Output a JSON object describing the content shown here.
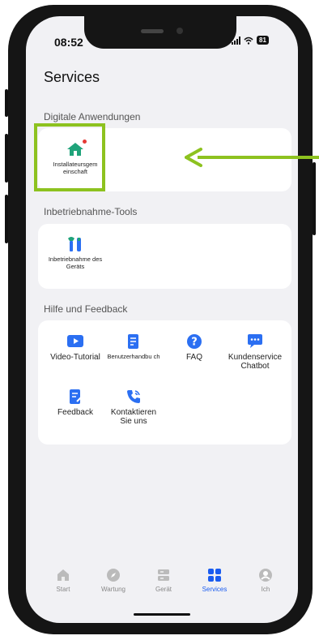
{
  "status": {
    "time": "08:52",
    "battery": "81"
  },
  "page": {
    "title": "Services"
  },
  "sections": {
    "digital": {
      "heading": "Digitale Anwendungen",
      "items": [
        {
          "label": "Installateursgem einschaft",
          "icon": "house-icon"
        }
      ]
    },
    "commissioning": {
      "heading": "Inbetriebnahme-Tools",
      "items": [
        {
          "label": "Inbetriebnahme des Geräts",
          "icon": "tools-icon"
        }
      ]
    },
    "help": {
      "heading": "Hilfe und Feedback",
      "items": [
        {
          "label": "Video-Tutorial",
          "icon": "play-icon"
        },
        {
          "label": "Benutzerhandbu ch",
          "icon": "manual-icon"
        },
        {
          "label": "FAQ",
          "icon": "question-icon"
        },
        {
          "label": "Kundenservice Chatbot",
          "icon": "chat-icon"
        },
        {
          "label": "Feedback",
          "icon": "feedback-icon"
        },
        {
          "label": "Kontaktieren Sie uns",
          "icon": "phone-icon"
        }
      ]
    }
  },
  "tabbar": [
    {
      "label": "Start",
      "icon": "home-tab-icon",
      "active": false
    },
    {
      "label": "Wartung",
      "icon": "compass-icon",
      "active": false
    },
    {
      "label": "Gerät",
      "icon": "device-icon",
      "active": false
    },
    {
      "label": "Services",
      "icon": "grid-icon",
      "active": true
    },
    {
      "label": "Ich",
      "icon": "user-icon",
      "active": false
    }
  ],
  "colors": {
    "accent": "#1a5cf0",
    "highlight": "#8dc21f",
    "icon_green": "#1fa37a",
    "icon_blue": "#2b6ff2"
  }
}
